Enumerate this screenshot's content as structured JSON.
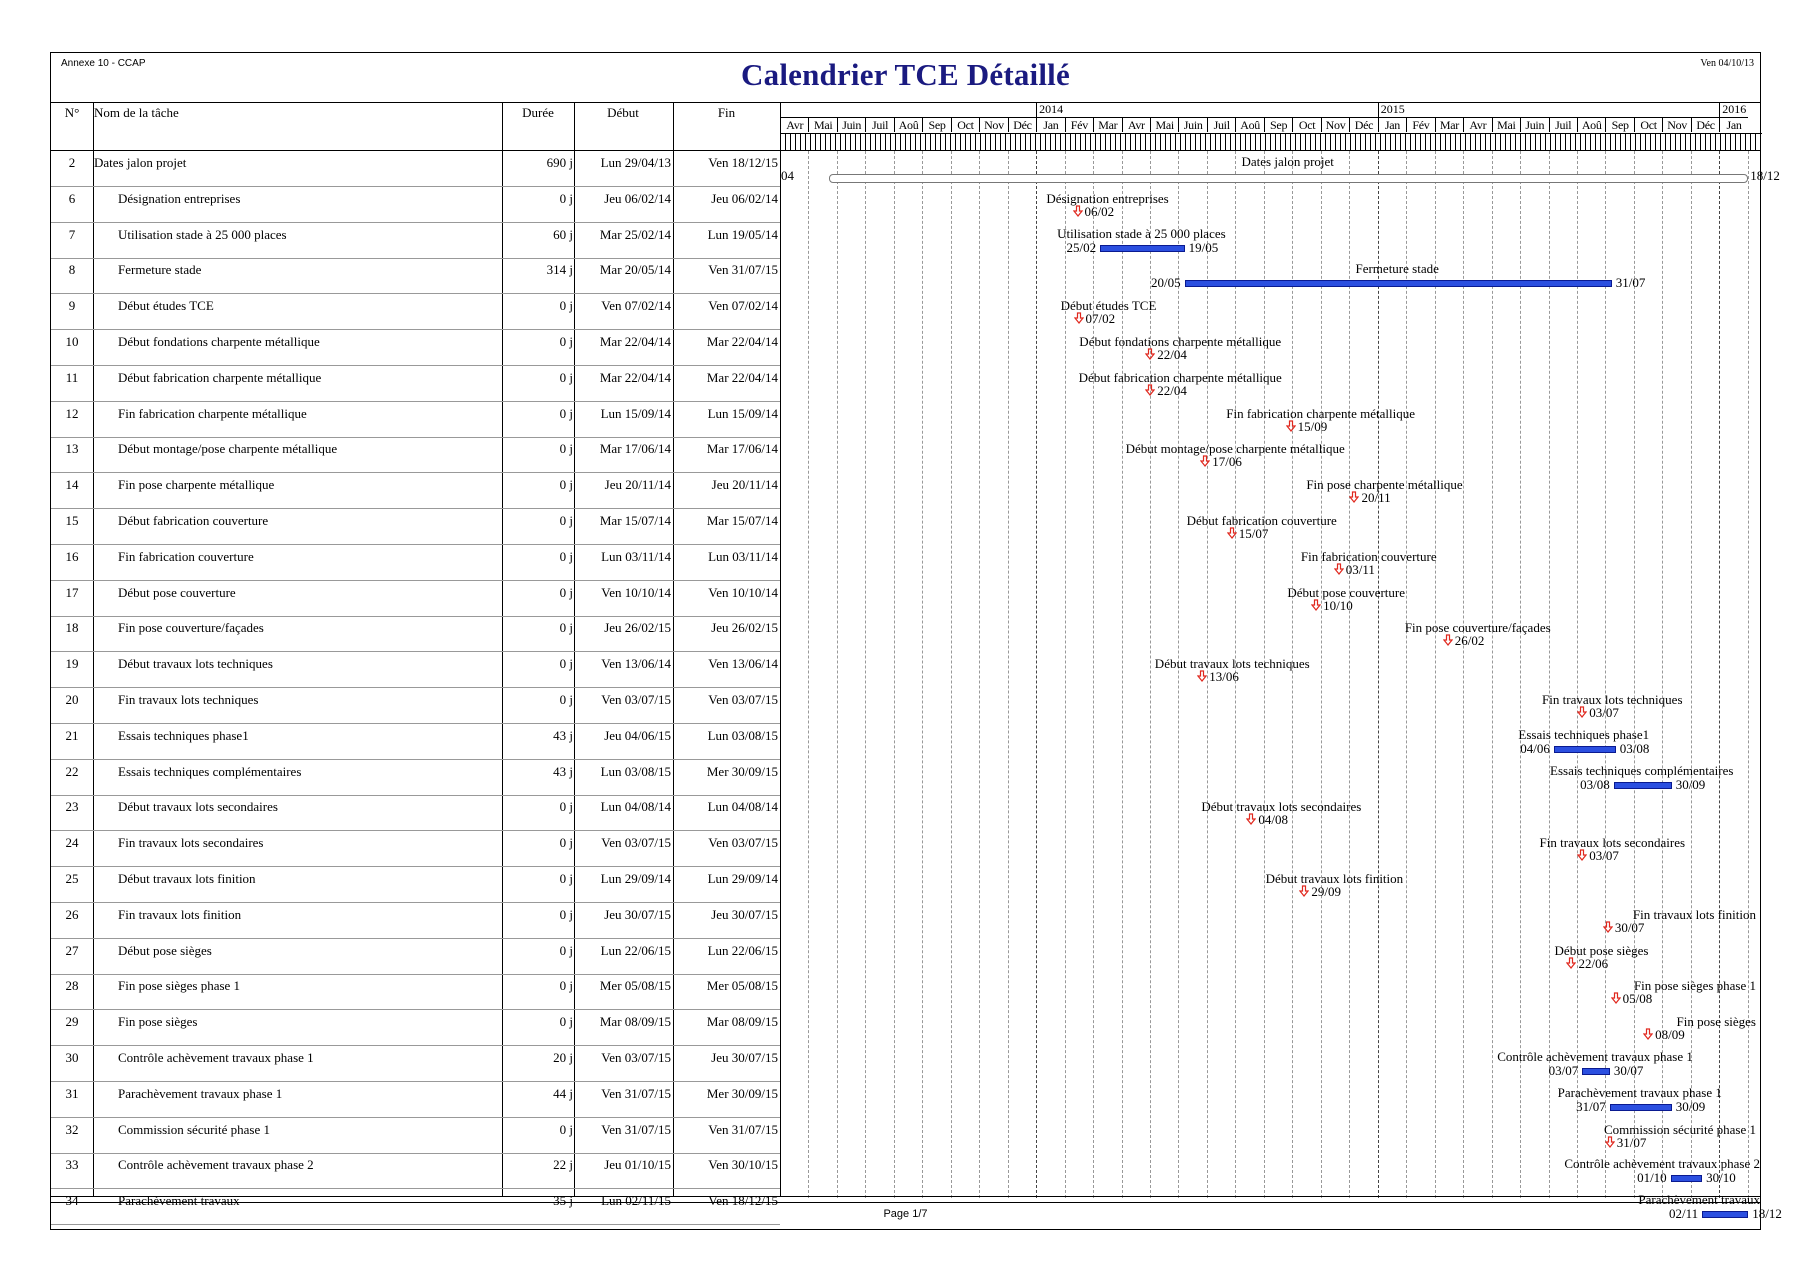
{
  "header": {
    "annex": "Annexe 10 - CCAP",
    "title": "Calendrier TCE Détaillé",
    "print_date": "Ven 04/10/13"
  },
  "columns": {
    "num": "N°",
    "name": "Nom de la tâche",
    "duration": "Durée",
    "start": "Début",
    "finish": "Fin"
  },
  "timescale": {
    "years": [
      "2014",
      "2015",
      "2016"
    ],
    "months": [
      "Avr",
      "Mai",
      "Juin",
      "Juil",
      "Aoû",
      "Sep",
      "Oct",
      "Nov",
      "Déc",
      "Jan",
      "Fév",
      "Mar",
      "Avr",
      "Mai",
      "Juin",
      "Juil",
      "Aoû",
      "Sep",
      "Oct",
      "Nov",
      "Déc",
      "Jan",
      "Fév",
      "Mar",
      "Avr",
      "Mai",
      "Juin",
      "Juil",
      "Aoû",
      "Sep",
      "Oct",
      "Nov",
      "Déc",
      "Jan"
    ]
  },
  "tasks": [
    {
      "num": "2",
      "name": "Dates jalon projet",
      "duration": "690 j",
      "start": "Lun 29/04/13",
      "finish": "Ven 18/12/15",
      "indent": 0,
      "gantt_label": "Dates jalon projet",
      "left_text": "04",
      "right_text": "18/12",
      "kind": "summary",
      "s": 0.05,
      "e": 0.984
    },
    {
      "num": "6",
      "name": "Désignation entreprises",
      "duration": "0 j",
      "start": "Jeu 06/02/14",
      "finish": "Jeu 06/02/14",
      "indent": 1,
      "gantt_label": "Désignation entreprises",
      "date_text": "06/02",
      "kind": "milestone",
      "s": 0.303
    },
    {
      "num": "7",
      "name": "Utilisation stade à 25 000 places",
      "duration": "60 j",
      "start": "Mar 25/02/14",
      "finish": "Lun 19/05/14",
      "indent": 1,
      "gantt_label": "Utilisation stade à 25 000 places",
      "left_text": "25/02",
      "right_text": "19/05",
      "kind": "bar",
      "s": 0.326,
      "e": 0.41
    },
    {
      "num": "8",
      "name": "Fermeture stade",
      "duration": "314 j",
      "start": "Mar 20/05/14",
      "finish": "Ven 31/07/15",
      "indent": 1,
      "gantt_label": "Fermeture stade",
      "left_text": "20/05",
      "right_text": "31/07",
      "kind": "bar",
      "s": 0.412,
      "e": 0.845
    },
    {
      "num": "9",
      "name": "Début études TCE",
      "duration": "0 j",
      "start": "Ven 07/02/14",
      "finish": "Ven 07/02/14",
      "indent": 1,
      "gantt_label": "Début études TCE",
      "date_text": "07/02",
      "kind": "milestone",
      "s": 0.304
    },
    {
      "num": "10",
      "name": "Début fondations charpente métallique",
      "duration": "0 j",
      "start": "Mar 22/04/14",
      "finish": "Mar 22/04/14",
      "indent": 1,
      "gantt_label": "Début fondations charpente métallique",
      "date_text": "22/04",
      "kind": "milestone",
      "s": 0.377
    },
    {
      "num": "11",
      "name": "Début fabrication charpente métallique",
      "duration": "0 j",
      "start": "Mar 22/04/14",
      "finish": "Mar 22/04/14",
      "indent": 1,
      "gantt_label": "Début fabrication charpente métallique",
      "date_text": "22/04",
      "kind": "milestone",
      "s": 0.377
    },
    {
      "num": "12",
      "name": "Fin fabrication charpente métallique",
      "duration": "0 j",
      "start": "Lun 15/09/14",
      "finish": "Lun 15/09/14",
      "indent": 1,
      "gantt_label": "Fin fabrication charpente métallique",
      "date_text": "15/09",
      "kind": "milestone",
      "s": 0.52
    },
    {
      "num": "13",
      "name": "Début montage/pose charpente métallique",
      "duration": "0 j",
      "start": "Mar 17/06/14",
      "finish": "Mar 17/06/14",
      "indent": 1,
      "gantt_label": "Début montage/pose charpente métallique",
      "date_text": "17/06",
      "kind": "milestone",
      "s": 0.433
    },
    {
      "num": "14",
      "name": "Fin pose charpente métallique",
      "duration": "0 j",
      "start": "Jeu 20/11/14",
      "finish": "Jeu 20/11/14",
      "indent": 1,
      "gantt_label": "Fin pose charpente métallique",
      "date_text": "20/11",
      "kind": "milestone",
      "s": 0.585
    },
    {
      "num": "15",
      "name": "Début fabrication couverture",
      "duration": "0 j",
      "start": "Mar 15/07/14",
      "finish": "Mar 15/07/14",
      "indent": 1,
      "gantt_label": "Début fabrication couverture",
      "date_text": "15/07",
      "kind": "milestone",
      "s": 0.46
    },
    {
      "num": "16",
      "name": "Fin fabrication couverture",
      "duration": "0 j",
      "start": "Lun 03/11/14",
      "finish": "Lun 03/11/14",
      "indent": 1,
      "gantt_label": "Fin fabrication couverture",
      "date_text": "03/11",
      "kind": "milestone",
      "s": 0.569
    },
    {
      "num": "17",
      "name": "Début pose couverture",
      "duration": "0 j",
      "start": "Ven 10/10/14",
      "finish": "Ven 10/10/14",
      "indent": 1,
      "gantt_label": "Début pose couverture",
      "date_text": "10/10",
      "kind": "milestone",
      "s": 0.546
    },
    {
      "num": "18",
      "name": "Fin pose couverture/façades",
      "duration": "0 j",
      "start": "Jeu 26/02/15",
      "finish": "Jeu 26/02/15",
      "indent": 1,
      "gantt_label": "Fin pose couverture/façades",
      "date_text": "26/02",
      "kind": "milestone",
      "s": 0.68
    },
    {
      "num": "19",
      "name": "Début travaux lots techniques",
      "duration": "0 j",
      "start": "Ven 13/06/14",
      "finish": "Ven 13/06/14",
      "indent": 1,
      "gantt_label": "Début travaux lots techniques",
      "date_text": "13/06",
      "kind": "milestone",
      "s": 0.43
    },
    {
      "num": "20",
      "name": "Fin travaux lots techniques",
      "duration": "0 j",
      "start": "Ven 03/07/15",
      "finish": "Ven 03/07/15",
      "indent": 1,
      "gantt_label": "Fin travaux lots techniques",
      "date_text": "03/07",
      "kind": "milestone",
      "s": 0.817
    },
    {
      "num": "21",
      "name": "Essais techniques phase1",
      "duration": "43 j",
      "start": "Jeu 04/06/15",
      "finish": "Lun 03/08/15",
      "indent": 1,
      "gantt_label": "Essais techniques phase1",
      "left_text": "04/06",
      "right_text": "03/08",
      "kind": "bar",
      "s": 0.788,
      "e": 0.849
    },
    {
      "num": "22",
      "name": "Essais techniques complémentaires",
      "duration": "43 j",
      "start": "Lun 03/08/15",
      "finish": "Mer 30/09/15",
      "indent": 1,
      "gantt_label": "Essais techniques complémentaires",
      "left_text": "03/08",
      "right_text": "30/09",
      "kind": "bar",
      "s": 0.849,
      "e": 0.906
    },
    {
      "num": "23",
      "name": "Début travaux lots secondaires",
      "duration": "0 j",
      "start": "Lun 04/08/14",
      "finish": "Lun 04/08/14",
      "indent": 1,
      "gantt_label": "Début travaux lots secondaires",
      "date_text": "04/08",
      "kind": "milestone",
      "s": 0.48
    },
    {
      "num": "24",
      "name": "Fin travaux lots secondaires",
      "duration": "0 j",
      "start": "Ven 03/07/15",
      "finish": "Ven 03/07/15",
      "indent": 1,
      "gantt_label": "Fin travaux lots secondaires",
      "date_text": "03/07",
      "kind": "milestone",
      "s": 0.817
    },
    {
      "num": "25",
      "name": "Début travaux lots finition",
      "duration": "0 j",
      "start": "Lun 29/09/14",
      "finish": "Lun 29/09/14",
      "indent": 1,
      "gantt_label": "Début travaux lots finition",
      "date_text": "29/09",
      "kind": "milestone",
      "s": 0.534
    },
    {
      "num": "26",
      "name": "Fin travaux lots finition",
      "duration": "0 j",
      "start": "Jeu 30/07/15",
      "finish": "Jeu 30/07/15",
      "indent": 1,
      "gantt_label": "Fin travaux lots finition",
      "date_text": "30/07",
      "kind": "milestone",
      "s": 0.843
    },
    {
      "num": "27",
      "name": "Début pose sièges",
      "duration": "0 j",
      "start": "Lun 22/06/15",
      "finish": "Lun 22/06/15",
      "indent": 1,
      "gantt_label": "Début pose sièges",
      "date_text": "22/06",
      "kind": "milestone",
      "s": 0.806
    },
    {
      "num": "28",
      "name": "Fin pose sièges phase 1",
      "duration": "0 j",
      "start": "Mer 05/08/15",
      "finish": "Mer 05/08/15",
      "indent": 1,
      "gantt_label": "Fin pose sièges phase 1",
      "date_text": "05/08",
      "kind": "milestone",
      "s": 0.851
    },
    {
      "num": "29",
      "name": "Fin pose sièges",
      "duration": "0 j",
      "start": "Mar 08/09/15",
      "finish": "Mar 08/09/15",
      "indent": 1,
      "gantt_label": "Fin pose sièges",
      "date_text": "08/09",
      "kind": "milestone",
      "s": 0.884
    },
    {
      "num": "30",
      "name": "Contrôle achèvement travaux phase 1",
      "duration": "20 j",
      "start": "Ven 03/07/15",
      "finish": "Jeu 30/07/15",
      "indent": 1,
      "gantt_label": "Contrôle achèvement travaux phase 1",
      "left_text": "03/07",
      "right_text": "30/07",
      "kind": "bar",
      "s": 0.817,
      "e": 0.843
    },
    {
      "num": "31",
      "name": "Parachèvement travaux phase 1",
      "duration": "44 j",
      "start": "Ven 31/07/15",
      "finish": "Mer 30/09/15",
      "indent": 1,
      "gantt_label": "Parachèvement travaux phase 1",
      "left_text": "31/07",
      "right_text": "30/09",
      "kind": "bar",
      "s": 0.845,
      "e": 0.906
    },
    {
      "num": "32",
      "name": "Commission sécurité phase 1",
      "duration": "0 j",
      "start": "Ven 31/07/15",
      "finish": "Ven 31/07/15",
      "indent": 1,
      "gantt_label": "Commission sécurité phase 1",
      "date_text": "31/07",
      "kind": "milestone",
      "s": 0.845
    },
    {
      "num": "33",
      "name": "Contrôle achèvement travaux phase 2",
      "duration": "22 j",
      "start": "Jeu 01/10/15",
      "finish": "Ven 30/10/15",
      "indent": 1,
      "gantt_label": "Contrôle achèvement travaux phase 2",
      "left_text": "01/10",
      "right_text": "30/10",
      "kind": "bar",
      "s": 0.907,
      "e": 0.937
    },
    {
      "num": "34",
      "name": "Parachèvement travaux",
      "duration": "35 j",
      "start": "Lun 02/11/15",
      "finish": "Ven 18/12/15",
      "indent": 1,
      "gantt_label": "Parachèvement travaux",
      "left_text": "02/11",
      "right_text": "18/12",
      "kind": "bar",
      "s": 0.939,
      "e": 0.984
    }
  ],
  "footer": {
    "page": "Page 1/7"
  },
  "colors": {
    "bar": "#2b4fe0",
    "milestone": "#e0281e",
    "title": "#1a1a80"
  }
}
